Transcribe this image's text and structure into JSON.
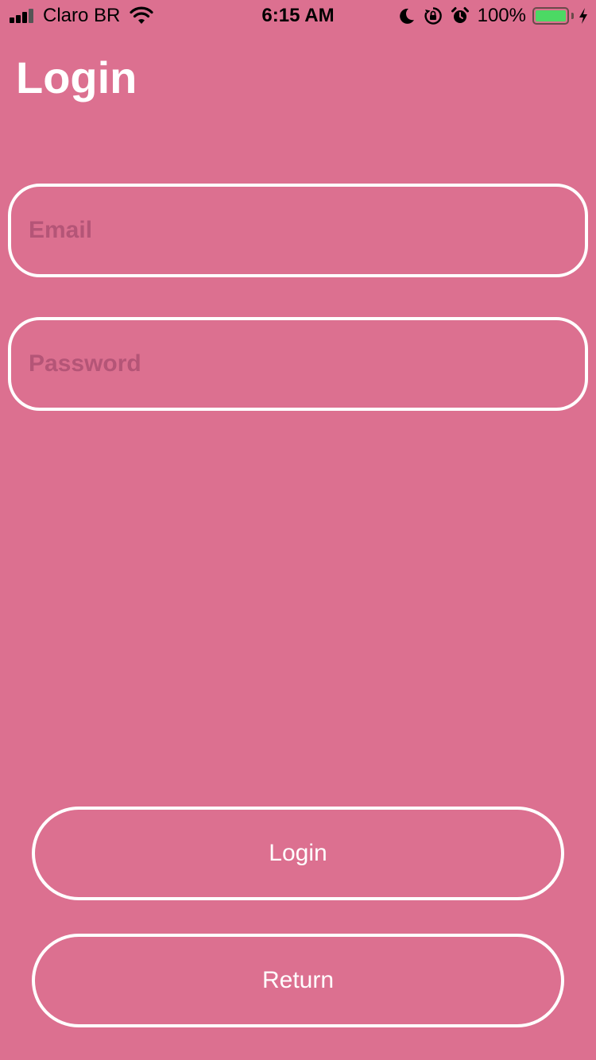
{
  "status_bar": {
    "carrier": "Claro BR",
    "time": "6:15 AM",
    "battery_percent": "100%",
    "battery_level": 1.0,
    "battery_color": "#4cd964",
    "icons": [
      "signal-icon",
      "wifi-icon",
      "moon-icon",
      "rotation-lock-icon",
      "alarm-icon",
      "battery-icon",
      "charging-bolt-icon"
    ]
  },
  "header": {
    "title": "Login"
  },
  "form": {
    "email_placeholder": "Email",
    "password_placeholder": "Password"
  },
  "actions": {
    "login_label": "Login",
    "return_label": "Return"
  },
  "colors": {
    "background": "#dc7090",
    "border": "#ffffff",
    "placeholder": "#b45577"
  }
}
